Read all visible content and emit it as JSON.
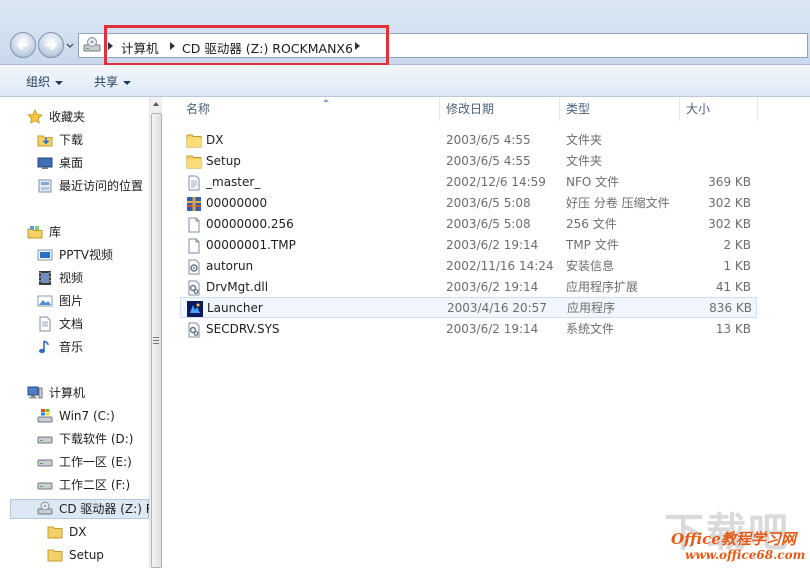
{
  "address_bar": {
    "crumbs": [
      "计算机",
      "CD 驱动器 (Z:) ROCKMANX6"
    ]
  },
  "command_bar": {
    "organize_label": "组织",
    "share_label": "共享"
  },
  "nav_pane": {
    "favorites": {
      "label": "收藏夹",
      "items": [
        "下载",
        "桌面",
        "最近访问的位置"
      ]
    },
    "libraries": {
      "label": "库",
      "items": [
        "PPTV视频",
        "视频",
        "图片",
        "文档",
        "音乐"
      ]
    },
    "computer": {
      "label": "计算机",
      "items": [
        "Win7 (C:)",
        "下载软件 (D:)",
        "工作一区 (E:)",
        "工作二区 (F:)",
        "CD 驱动器 (Z:) R",
        "DX",
        "Setup"
      ]
    }
  },
  "columns": {
    "name": "名称",
    "date": "修改日期",
    "type": "类型",
    "size": "大小"
  },
  "files": [
    {
      "name": "DX",
      "date": "2003/6/5 4:55",
      "type": "文件夹",
      "size": "",
      "icon": "folder-icon"
    },
    {
      "name": "Setup",
      "date": "2003/6/5 4:55",
      "type": "文件夹",
      "size": "",
      "icon": "folder-icon"
    },
    {
      "name": "_master_",
      "date": "2002/12/6 14:59",
      "type": "NFO 文件",
      "size": "369 KB",
      "icon": "text-file-icon"
    },
    {
      "name": "00000000",
      "date": "2003/6/5 5:08",
      "type": "好压 分卷 压缩文件",
      "size": "302 KB",
      "icon": "archive-icon"
    },
    {
      "name": "00000000.256",
      "date": "2003/6/5 5:08",
      "type": "256 文件",
      "size": "302 KB",
      "icon": "blank-file-icon"
    },
    {
      "name": "00000001.TMP",
      "date": "2003/6/2 19:14",
      "type": "TMP 文件",
      "size": "2 KB",
      "icon": "blank-file-icon"
    },
    {
      "name": "autorun",
      "date": "2002/11/16 14:24",
      "type": "安装信息",
      "size": "1 KB",
      "icon": "settings-file-icon"
    },
    {
      "name": "DrvMgt.dll",
      "date": "2003/6/2 19:14",
      "type": "应用程序扩展",
      "size": "41 KB",
      "icon": "dll-file-icon"
    },
    {
      "name": "Launcher",
      "date": "2003/4/16 20:57",
      "type": "应用程序",
      "size": "836 KB",
      "icon": "app-icon"
    },
    {
      "name": "SECDRV.SYS",
      "date": "2003/6/2 19:14",
      "type": "系统文件",
      "size": "13 KB",
      "icon": "sys-file-icon"
    }
  ],
  "watermark": {
    "big": "下载吧",
    "title": "Office教程学习网",
    "url": "www.office68.com"
  }
}
